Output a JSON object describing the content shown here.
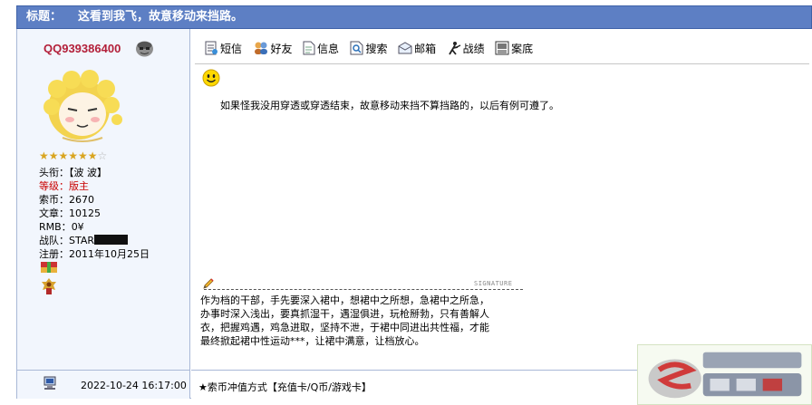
{
  "title": {
    "label": "标题：",
    "text": "这看到我飞，故意移动来挡路。"
  },
  "user": {
    "name": "QQ939386400",
    "stars_on": "★★★★★★",
    "stars_off": "☆",
    "stats": [
      {
        "label": "头衔：",
        "value": "【波 波】"
      },
      {
        "label": "等级：",
        "value": "版主"
      },
      {
        "label": "索币：",
        "value": "2670"
      },
      {
        "label": "文章：",
        "value": "10125"
      },
      {
        "label": "RMB：",
        "value": "0¥"
      },
      {
        "label": "战队：",
        "value": "STAR"
      },
      {
        "label": "注册：",
        "value": "2011年10月25日"
      }
    ]
  },
  "toolbar": {
    "sms": "短信",
    "friend": "好友",
    "info": "信息",
    "search": "搜索",
    "mail": "邮箱",
    "record": "战绩",
    "case": "案底"
  },
  "post": {
    "body": "如果怪我没用穿透或穿透结束，故意移动来挡不算挡路的，以后有例可遵了。"
  },
  "signature": {
    "label": "SIGNATURE",
    "text": "作为档的干部，手先要深入裙中，想裙中之所想，急裙中之所急，办事时深入浅出，要真抓湿干，遇湿俱进，玩枪掰勃，只有善解人衣，把握鸡遇，鸡急进取，坚持不泄，于裙中同进出共性福，才能最终掀起裙中性运动***，让裙中满意，让档放心。"
  },
  "footer": {
    "date": "2022-10-24 16:17:00",
    "text": "★索币冲值方式【充值卡/Q币/游戏卡】"
  },
  "colors": {
    "title_bg": "#5d7fc4",
    "left_bg": "#f2f6fd",
    "border": "#a9b8d7",
    "username": "#b3203a",
    "level_red": "#c80000"
  }
}
